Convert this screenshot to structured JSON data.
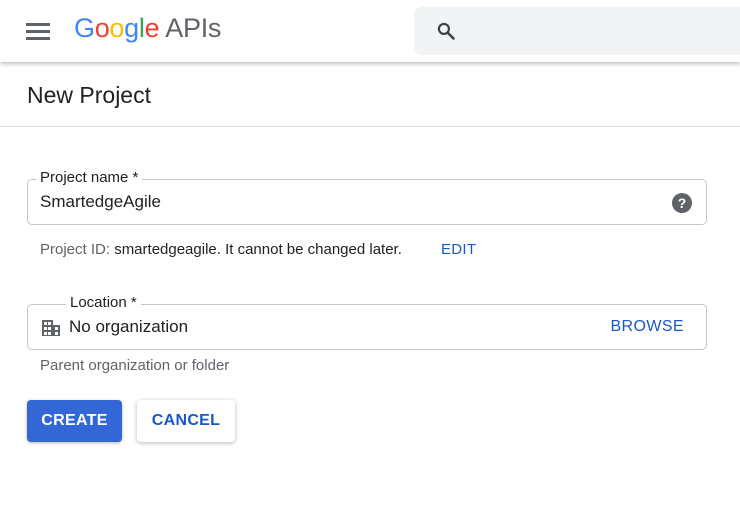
{
  "header": {
    "logo_google": "Google",
    "logo_apis": "APIs",
    "menu_icon": "hamburger-menu-icon",
    "search_icon": "search-icon"
  },
  "page": {
    "title": "New Project"
  },
  "form": {
    "project_name": {
      "label": "Project name *",
      "value": "SmartedgeAgile",
      "help_icon": "help-icon"
    },
    "project_id": {
      "prefix": "Project ID: ",
      "id": "smartedgeagile",
      "suffix": ". It cannot be changed later.",
      "edit_label": "EDIT"
    },
    "location": {
      "label": "Location *",
      "value": "No organization",
      "icon": "building-icon",
      "browse_label": "BROWSE",
      "hint": "Parent organization or folder"
    }
  },
  "actions": {
    "create_label": "CREATE",
    "cancel_label": "CANCEL"
  },
  "colors": {
    "google_blue": "#4285F4",
    "google_red": "#EA4335",
    "google_yellow": "#FBBC05",
    "google_green": "#34A853",
    "primary": "#3367d6",
    "link": "#1a56c7"
  }
}
